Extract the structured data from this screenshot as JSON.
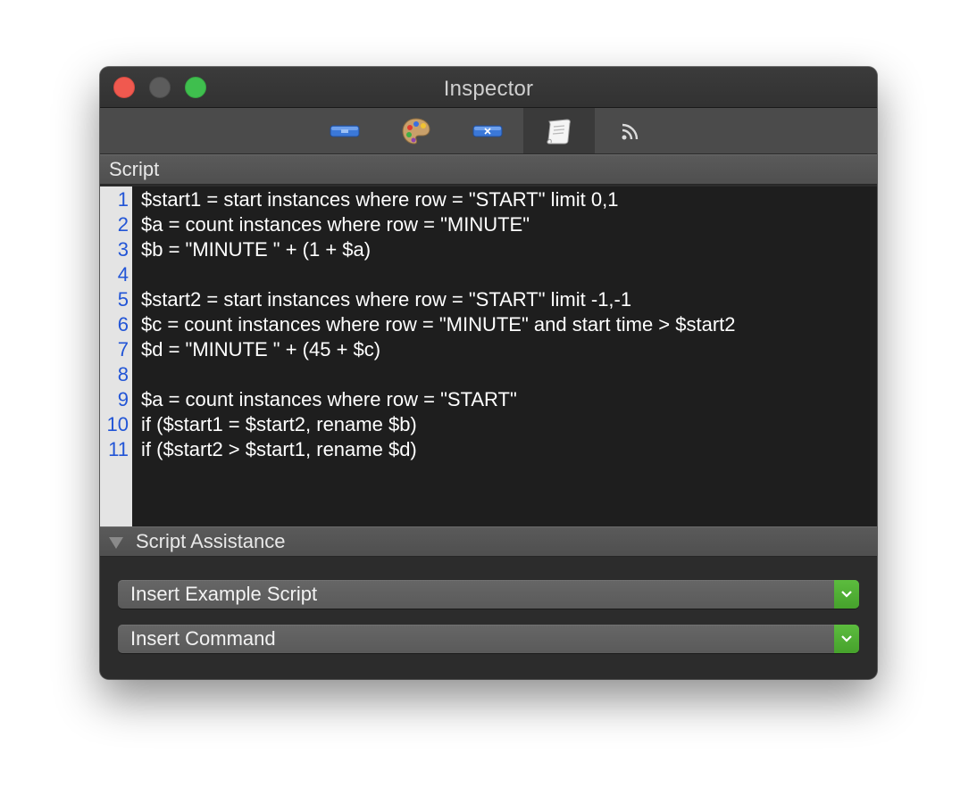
{
  "window": {
    "title": "Inspector"
  },
  "toolbar": {
    "tools": [
      {
        "icon": "blue-bar-icon"
      },
      {
        "icon": "palette-icon"
      },
      {
        "icon": "variable-x-icon"
      },
      {
        "icon": "script-scroll-icon",
        "selected": true
      },
      {
        "icon": "rss-feed-icon"
      }
    ]
  },
  "script": {
    "header": "Script",
    "line_numbers": [
      "1",
      "2",
      "3",
      "4",
      "5",
      "6",
      "7",
      "8",
      "9",
      "10",
      "11"
    ],
    "lines": [
      "$start1 = start instances where row = \"START\" limit 0,1",
      "$a = count instances where row = \"MINUTE\"",
      "$b = \"MINUTE \" + (1 + $a)",
      "",
      "$start2 = start instances where row = \"START\" limit -1,-1",
      "$c = count instances where row = \"MINUTE\" and start time > $start2",
      "$d = \"MINUTE \" + (45 + $c)",
      "",
      "$a = count instances where row = \"START\"",
      "if ($start1 = $start2, rename $b)",
      "if ($start2 > $start1, rename $d)"
    ]
  },
  "assistance": {
    "header": "Script Assistance",
    "example_popup": "Insert Example Script",
    "command_popup": "Insert Command"
  },
  "colors": {
    "line_number": "#2255d6",
    "popup_arrow": "#4fae33",
    "close": "#f0594f",
    "zoom": "#3fbf4e"
  }
}
